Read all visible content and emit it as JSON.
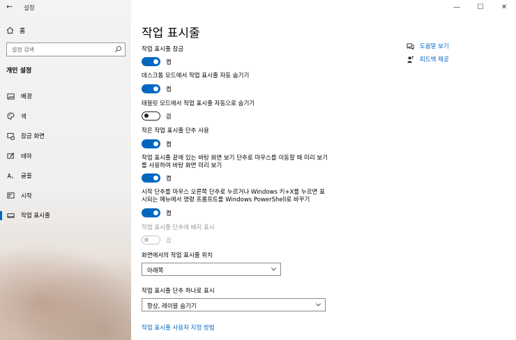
{
  "app": {
    "title": "설정"
  },
  "sidebar": {
    "home_label": "홈",
    "search_placeholder": "설정 검색",
    "section_title": "개인 설정",
    "items": [
      {
        "label": "배경",
        "icon": "picture-icon"
      },
      {
        "label": "색",
        "icon": "palette-icon"
      },
      {
        "label": "잠금 화면",
        "icon": "lock-screen-icon"
      },
      {
        "label": "테마",
        "icon": "brush-icon"
      },
      {
        "label": "글꼴",
        "icon": "font-icon"
      },
      {
        "label": "시작",
        "icon": "start-icon"
      },
      {
        "label": "작업 표시줄",
        "icon": "taskbar-icon",
        "active": true
      }
    ]
  },
  "window_controls": {
    "minimize": "—",
    "maximize": "☐",
    "close": "✕"
  },
  "main": {
    "title": "작업 표시줄",
    "settings": [
      {
        "label": "작업 표시줄 잠금",
        "state": "켬",
        "on": true
      },
      {
        "label": "데스크톱 모드에서 작업 표시줄 자동 숨기기",
        "state": "켬",
        "on": true
      },
      {
        "label": "태블릿 모드에서 작업 표시줄 자동으로 숨기기",
        "state": "끔",
        "on": false
      },
      {
        "label": "작은 작업 표시줄 단추 사용",
        "state": "켬",
        "on": true
      },
      {
        "label": "작업 표시줄 끝에 있는 바탕 화면 보기 단추로 마우스를 이동할 때 미리 보기를 사용하여 바탕 화면 미리 보기",
        "state": "켬",
        "on": true
      },
      {
        "label": "시작 단추를 마우스 오른쪽 단추로 누르거나 Windows 키+X를 누르면 표시되는 메뉴에서 명령 프롬프트를 Windows PowerShell로 바꾸기",
        "state": "켬",
        "on": true
      },
      {
        "label": "작업 표시줄 단추에 배지 표시",
        "state": "끔",
        "on": false,
        "disabled": true
      }
    ],
    "position": {
      "label": "화면에서의 작업 표시줄 위치",
      "value": "아래쪽"
    },
    "combine": {
      "label": "작업 표시줄 단추 하나로 표시",
      "value": "항상, 레이블 숨기기"
    },
    "customize_link": "작업 표시줄 사용자 지정 방법"
  },
  "help": {
    "get_help": "도움말 보기",
    "feedback": "피드백 제공"
  },
  "colors": {
    "accent": "#0067c0"
  }
}
